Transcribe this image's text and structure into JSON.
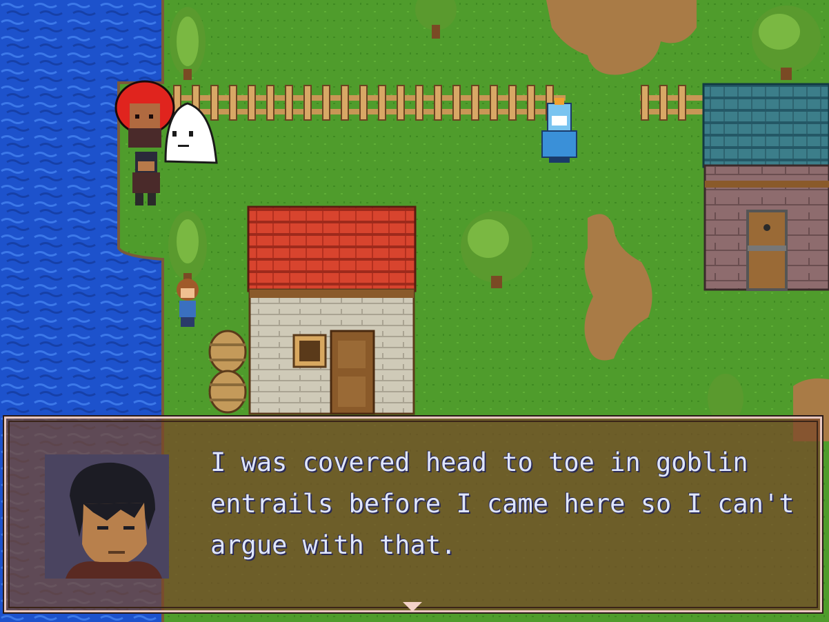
{
  "scene": {
    "name": "village-map",
    "colors": {
      "grass": "#4c9a2a",
      "water": "#1c50c8",
      "dirt": "#a77a45",
      "roof_red": "#d0402c",
      "roof_teal": "#3a7a86",
      "wall": "#c8c4b8",
      "stone": "#8c6a6a"
    }
  },
  "dialog": {
    "speaker_portrait": "dark-haired-man-portrait",
    "message": "I was covered head to toe in goblin\nentrails before I came here so I can't\nargue with that.",
    "continue_icon": "down-triangle-icon"
  }
}
